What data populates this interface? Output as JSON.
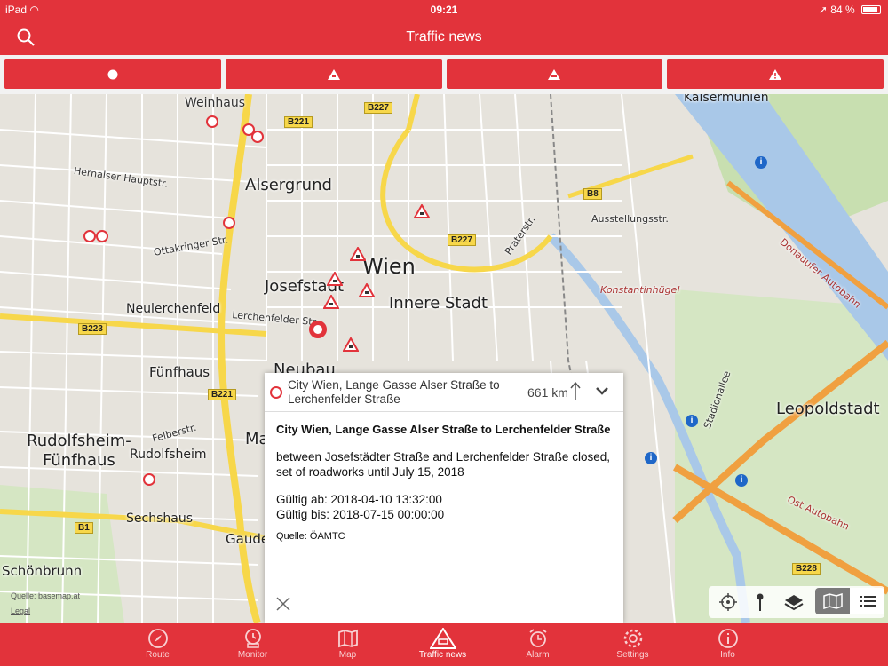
{
  "status": {
    "device": "iPad",
    "time": "09:21",
    "battery": "84 %"
  },
  "header": {
    "title": "Traffic news"
  },
  "map": {
    "labels": {
      "weinhaus": "Weinhaus",
      "alsergrund": "Alsergrund",
      "wien": "Wien",
      "josefstadt": "Josefstadt",
      "innere_stadt": "Innere Stadt",
      "neulerchenfeld": "Neulerchenfeld",
      "fuenfhaus": "Fünfhaus",
      "rudolfsheim": "Rudolfsheim-\nFünfhaus",
      "rudolfsheim_small": "Rudolfsheim",
      "sechshaus": "Sechshaus",
      "schoenbrunn": "Schönbrunn",
      "leopoldstadt": "Leopoldstadt",
      "konstantinhuegel": "Konstantinhügel",
      "kaisermuehlen": "Kaisermühlen",
      "ausstellungsstr": "Ausstellungsstr.",
      "donauufer": "Donauufer Autobahn",
      "ost_autobahn": "Ost Autobahn",
      "neubau": "Neubau",
      "gaudenz": "Gaude",
      "ma": "Ma",
      "hernalser": "Hernalser Hauptstr.",
      "ottakringer": "Ottakringer Str.",
      "lerchenfelder": "Lerchenfelder Str.",
      "felberstr": "Felberstr.",
      "praterstr": "Praterstr.",
      "stadionallee": "Stadionallee"
    },
    "shields": [
      "B221",
      "B227",
      "B227",
      "B8",
      "B223",
      "B221",
      "B1",
      "B228"
    ],
    "attribution": {
      "source": "Quelle: basemap.at",
      "legal": "Legal"
    }
  },
  "popup": {
    "title": "City Wien, Lange Gasse Alser Straße to Lerchenfelder Straße",
    "distance": "661 km",
    "heading": "City Wien, Lange Gasse Alser Straße to Lerchenfelder Straße",
    "description": "between Josefstädter Straße and Lerchenfelder Straße closed, set of roadworks until July 15, 2018",
    "valid_from": "Gültig ab: 2018-04-10 13:32:00",
    "valid_to": "Gültig bis: 2018-07-15 00:00:00",
    "source": "Quelle: ÖAMTC"
  },
  "tabs": [
    {
      "label": "Route",
      "icon": "compass-icon"
    },
    {
      "label": "Monitor",
      "icon": "monitor-icon"
    },
    {
      "label": "Map",
      "icon": "map-icon"
    },
    {
      "label": "Traffic news",
      "icon": "traffic-news-icon"
    },
    {
      "label": "Alarm",
      "icon": "alarm-clock-icon"
    },
    {
      "label": "Settings",
      "icon": "gear-icon"
    },
    {
      "label": "Info",
      "icon": "info-icon"
    }
  ],
  "colors": {
    "accent": "#e2333b",
    "tab_inactive": "#f8d1d3",
    "motorway": "#f0a040",
    "primary_road": "#f7d74a",
    "water": "#a9c8e8",
    "park": "#c8dfb0"
  }
}
